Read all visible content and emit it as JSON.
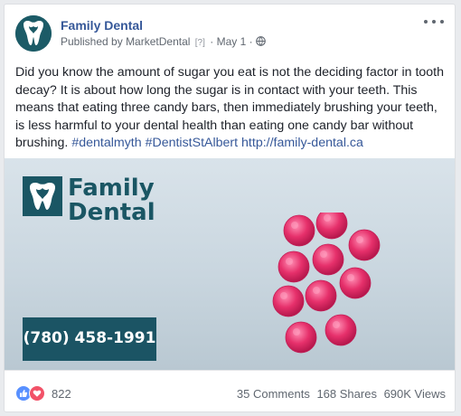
{
  "post": {
    "page_name": "Family Dental",
    "published_by_prefix": "Published by",
    "publisher": "MarketDental",
    "help_marker": "[?]",
    "separator": "·",
    "date": "May 1",
    "separator_2": "·",
    "text_body": "Did you know the amount of sugar you eat is not the deciding factor in tooth decay? It is about how long the sugar is in contact with your teeth. This means that eating three candy bars, then immediately brushing your teeth, is less harmful to your dental health than eating one candy bar without brushing.",
    "hashtag_1": "#dentalmyth",
    "hashtag_2": "#DentistStAlbert",
    "link": "http://family-dental.ca"
  },
  "image": {
    "brand_line_1": "Family",
    "brand_line_2": "Dental",
    "phone": "(780) 458-1991"
  },
  "footer": {
    "reaction_count": "822",
    "comments": "35 Comments",
    "shares": "168 Shares",
    "views": "690K Views"
  },
  "colors": {
    "brand_teal": "#1a5664",
    "link_blue": "#365899",
    "candy_pink": "#e6306b"
  },
  "icons": [
    "more-options-icon",
    "globe-icon",
    "like-reaction-icon",
    "love-reaction-icon",
    "tooth-logo-icon"
  ]
}
